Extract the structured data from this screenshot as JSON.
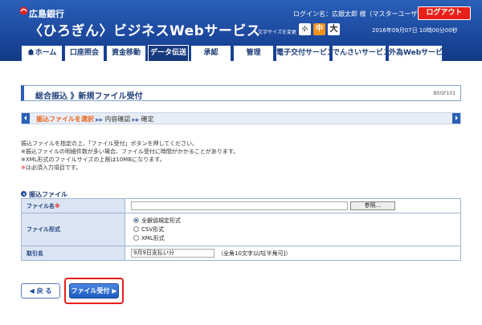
{
  "header": {
    "bank_name": "広島銀行",
    "app_title": "〈ひろぎん〉ビジネスWebサービス",
    "login_info": "ログイン名：広銀太郎 様（マスターユーザ）",
    "logout_label": "ログアウト",
    "font_size_label": "文字サイズを変更",
    "font_small": "小",
    "font_medium": "中",
    "font_large": "大",
    "datetime": "2016年09月07日 10時00分00秒"
  },
  "nav": {
    "items": [
      {
        "label": "ホーム"
      },
      {
        "label": "口座照会"
      },
      {
        "label": "資金移動"
      },
      {
        "label": "データ伝送"
      },
      {
        "label": "承認"
      },
      {
        "label": "管理"
      },
      {
        "label": "電子交付サービス"
      },
      {
        "label": "でんさいサービス"
      },
      {
        "label": "外為Webサービス"
      }
    ],
    "active_index": 3
  },
  "page": {
    "title": "総合振込 》新規ファイル受付",
    "screen_id": "BSGF101"
  },
  "steps": {
    "current": "振込ファイルを選択",
    "next1": "内容確認",
    "next2": "確定"
  },
  "instructions": {
    "line1": "振込ファイルを指定の上、「ファイル受付」ボタンを押してください。",
    "line2": "※振込ファイルの明細件数が多い場合、ファイル受付に時間がかかることがあります。",
    "line3": "※XML形式のファイルサイズの上限は10MBになります。",
    "line4_mark": "※",
    "line4": "は必須入力項目です。"
  },
  "section": {
    "heading": "振込ファイル"
  },
  "form": {
    "file_name_label": "ファイル名",
    "required_mark": "※",
    "browse_label": "参照...",
    "file_format_label": "ファイル形式",
    "format_options": [
      "全銀協規定形式",
      "CSV形式",
      "XML形式"
    ],
    "format_selected": 0,
    "transaction_name_label": "取引名",
    "transaction_name_value": "9月9日支払い分",
    "transaction_hint": "（全角10文字以内[半角可]）"
  },
  "buttons": {
    "back_label": "戻 る",
    "submit_label": "ファイル受付"
  },
  "colors": {
    "header_blue": "#1d4aa0",
    "logout_red": "#e8201a",
    "step_current": "#e8621a",
    "font_mid_orange": "#f5921e"
  }
}
